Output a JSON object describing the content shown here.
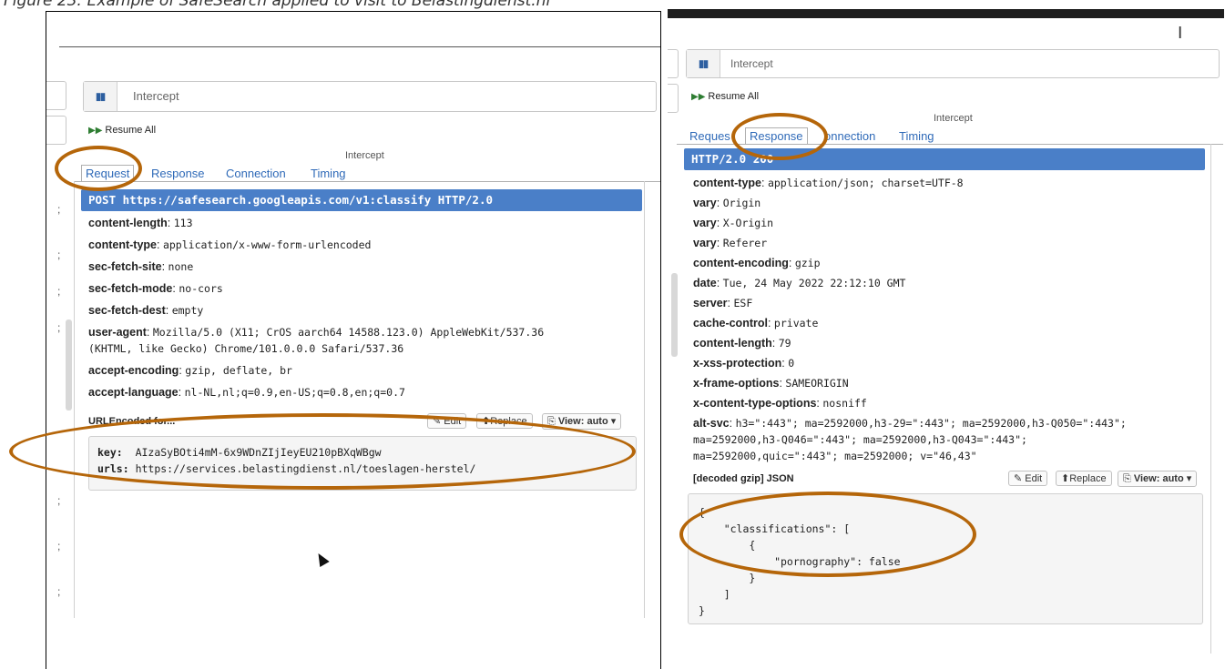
{
  "caption": "Figure 23: Example of SafeSearch applied to visit to Belastingdienst.nl",
  "common": {
    "intercept_placeholder": "Intercept",
    "pause_icon": "pause-icon",
    "resume_all": "Resume All",
    "intercept_section": "Intercept",
    "tabs": [
      "Request",
      "Response",
      "Connection",
      "Timing"
    ],
    "edit_btn": "Edit",
    "replace_btn": "Replace",
    "view_btn": "View: auto",
    "annotation_color": "#b5660a",
    "accent_color": "#4a7fc8"
  },
  "left": {
    "tab_first": "Request",
    "first_line": "POST https://safesearch.googleapis.com/v1:classify HTTP/2.0",
    "headers": [
      {
        "k": "content-length",
        "v": "113"
      },
      {
        "k": "content-type",
        "v": "application/x-www-form-urlencoded"
      },
      {
        "k": "sec-fetch-site",
        "v": "none"
      },
      {
        "k": "sec-fetch-mode",
        "v": "no-cors"
      },
      {
        "k": "sec-fetch-dest",
        "v": "empty"
      },
      {
        "k": "user-agent",
        "v": "Mozilla/5.0 (X11; CrOS aarch64 14588.123.0) AppleWebKit/537.36"
      },
      {
        "k": "",
        "v": "(KHTML, like Gecko) Chrome/101.0.0.0 Safari/537.36"
      },
      {
        "k": "accept-encoding",
        "v": "gzip, deflate, br"
      },
      {
        "k": "accept-language",
        "v": "nl-NL,nl;q=0.9,en-US;q=0.8,en;q=0.7"
      }
    ],
    "content_label": "URLEncoded for...",
    "form": [
      {
        "k": "key:",
        "v": "AIzaSyBOti4mM-6x9WDnZIjIeyEU210pBXqWBgw"
      },
      {
        "k": "urls:",
        "v": "https://services.belastingdienst.nl/toeslagen-herstel/"
      }
    ]
  },
  "right": {
    "ibeam": "I",
    "tab_first": "Reques",
    "tab_third": "onnection",
    "first_line": "HTTP/2.0 200",
    "headers": [
      {
        "k": "content-type",
        "v": "application/json; charset=UTF-8"
      },
      {
        "k": "vary",
        "v": "Origin"
      },
      {
        "k": "vary",
        "v": "X-Origin"
      },
      {
        "k": "vary",
        "v": "Referer"
      },
      {
        "k": "content-encoding",
        "v": "gzip"
      },
      {
        "k": "date",
        "v": "Tue, 24 May 2022 22:12:10 GMT"
      },
      {
        "k": "server",
        "v": "ESF"
      },
      {
        "k": "cache-control",
        "v": "private"
      },
      {
        "k": "content-length",
        "v": "79"
      },
      {
        "k": "x-xss-protection",
        "v": "0"
      },
      {
        "k": "x-frame-options",
        "v": "SAMEORIGIN"
      },
      {
        "k": "x-content-type-options",
        "v": "nosniff"
      },
      {
        "k": "alt-svc",
        "v": "h3=\":443\"; ma=2592000,h3-29=\":443\"; ma=2592000,h3-Q050=\":443\";"
      }
    ],
    "alt_svc_cont": [
      "ma=2592000,h3-Q046=\":443\"; ma=2592000,h3-Q043=\":443\";",
      "ma=2592000,quic=\":443\"; ma=2592000; v=\"46,43\""
    ],
    "content_label": "[decoded gzip] JSON",
    "json_lines": [
      "{",
      "    \"classifications\": [",
      "        {",
      "            \"pornography\": false",
      "        }",
      "    ]",
      "}"
    ]
  }
}
